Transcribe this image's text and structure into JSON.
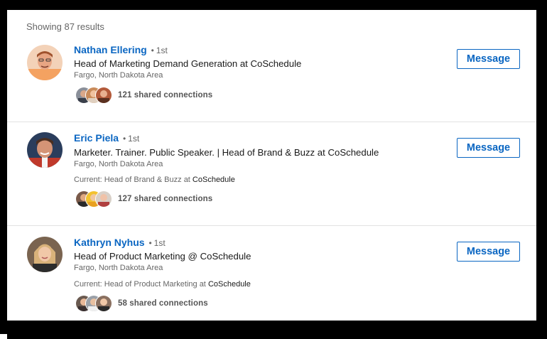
{
  "results": {
    "count_text": "Showing 87 results",
    "people": [
      {
        "name": "Nathan Ellering",
        "degree": "1st",
        "headline": "Head of Marketing Demand Generation at CoSchedule",
        "location": "Fargo, North Dakota Area",
        "current_prefix": "",
        "current_company": "",
        "shared_connections": "121 shared connections",
        "button_label": "Message",
        "avatar_colors": {
          "bg": "#f0c9a8",
          "skin": "#e8a583",
          "hair": "#a0522d",
          "shirt": "#f4a261"
        }
      },
      {
        "name": "Eric Piela",
        "degree": "1st",
        "headline": "Marketer. Trainer. Public Speaker. | Head of Brand & Buzz at CoSchedule",
        "location": "Fargo, North Dakota Area",
        "current_prefix": "Current: Head of Brand & Buzz at ",
        "current_company": "CoSchedule",
        "shared_connections": "127 shared connections",
        "button_label": "Message",
        "avatar_colors": {
          "bg": "#2a3d5c",
          "skin": "#d49476",
          "hair": "#4a2e1f",
          "shirt": "#c0392b"
        }
      },
      {
        "name": "Kathryn Nyhus",
        "degree": "1st",
        "headline": "Head of Product Marketing @ CoSchedule",
        "location": "Fargo, North Dakota Area",
        "current_prefix": "Current: Head of Product Marketing at ",
        "current_company": "CoSchedule",
        "shared_connections": "58 shared connections",
        "button_label": "Message",
        "avatar_colors": {
          "bg": "#7a6450",
          "skin": "#f1c8a8",
          "hair": "#d9b27a",
          "shirt": "#2c2c2c"
        }
      }
    ]
  },
  "colors": {
    "link": "#0a66c2",
    "muted": "#666666",
    "text": "#1a1a1a",
    "divider": "#e2e2e2"
  }
}
